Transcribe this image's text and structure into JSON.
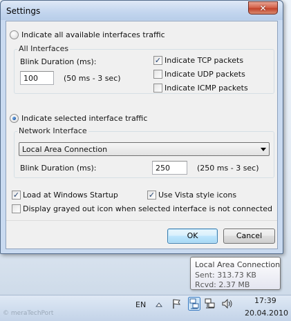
{
  "window": {
    "title": "Settings",
    "close_glyph": "✕"
  },
  "all_interfaces": {
    "radio_label": "Indicate all available interfaces traffic",
    "radio_checked": false,
    "group_label": "All Interfaces",
    "blink_label": "Blink Duration (ms):",
    "blink_value": "100",
    "blink_range": "(50 ms - 3 sec)",
    "tcp_label": "Indicate TCP packets",
    "tcp_checked": true,
    "udp_label": "Indicate UDP packets",
    "udp_checked": false,
    "icmp_label": "Indicate ICMP packets",
    "icmp_checked": false
  },
  "selected_interface": {
    "radio_label": "Indicate selected interface traffic",
    "radio_checked": true,
    "group_label": "Network Interface",
    "interface_value": "Local Area Connection",
    "blink_label": "Blink Duration (ms):",
    "blink_value": "250",
    "blink_range": "(250 ms - 3 sec)"
  },
  "options": {
    "load_startup_label": "Load at Windows Startup",
    "load_startup_checked": true,
    "vista_icons_label": "Use Vista style icons",
    "vista_icons_checked": true,
    "grayed_icon_label": "Display grayed out icon when selected interface is not connected",
    "grayed_icon_checked": false
  },
  "buttons": {
    "ok": "OK",
    "cancel": "Cancel"
  },
  "tooltip": {
    "title": "Local Area Connection",
    "sent": "Sent: 313.73 KB",
    "rcvd": "Rcvd: 2.37 MB"
  },
  "taskbar": {
    "language": "EN",
    "time": "17:39",
    "date": "20.04.2010",
    "icons": [
      "show-hidden-icons-arrow",
      "action-center-flag",
      "network-monitor",
      "network",
      "volume"
    ]
  },
  "watermark": "© meraTechPort"
}
